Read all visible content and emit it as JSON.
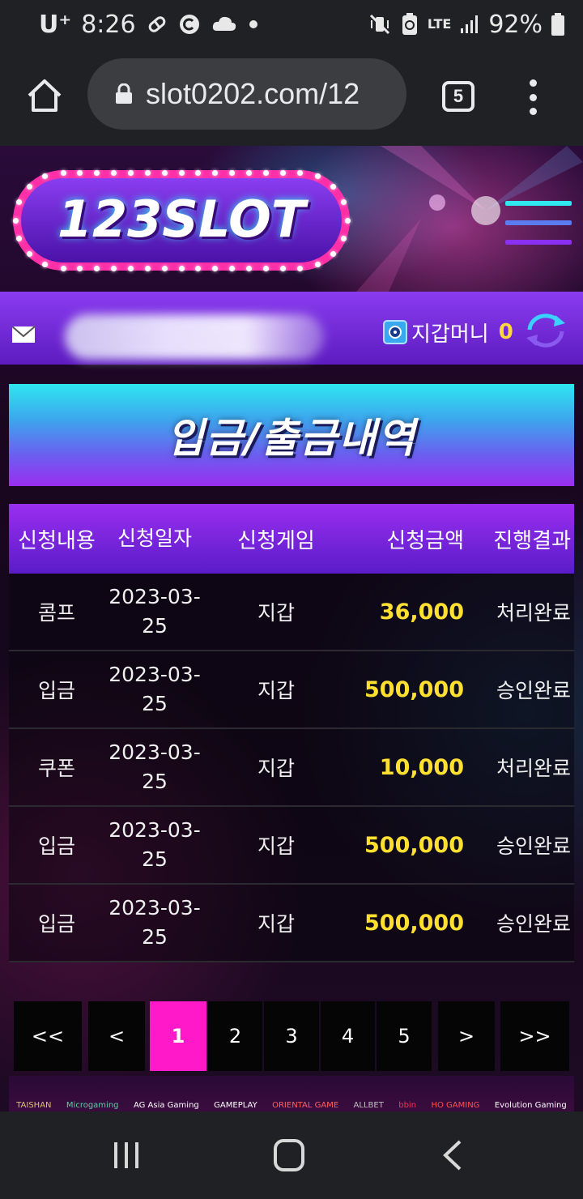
{
  "statusbar": {
    "carrier": "U⁺",
    "time": "8:26",
    "battery": "92%",
    "lte": "LTE"
  },
  "browser": {
    "url": "slot0202.com/12",
    "tab_count": "5"
  },
  "site": {
    "logo_text": "123SLOT",
    "wallet_label": "지갑머니",
    "wallet_amount": "0",
    "page_title": "입금/출금내역"
  },
  "table": {
    "headers": [
      "신청내용",
      "신청일자",
      "신청게임",
      "신청금액",
      "진행결과"
    ],
    "rows": [
      {
        "type": "콤프",
        "date": "2023-03-25",
        "game": "지갑",
        "amount": "36,000",
        "result": "처리완료"
      },
      {
        "type": "입금",
        "date": "2023-03-25",
        "game": "지갑",
        "amount": "500,000",
        "result": "승인완료"
      },
      {
        "type": "쿠폰",
        "date": "2023-03-25",
        "game": "지갑",
        "amount": "10,000",
        "result": "처리완료"
      },
      {
        "type": "입금",
        "date": "2023-03-25",
        "game": "지갑",
        "amount": "500,000",
        "result": "승인완료"
      },
      {
        "type": "입금",
        "date": "2023-03-25",
        "game": "지갑",
        "amount": "500,000",
        "result": "승인완료"
      }
    ]
  },
  "pagination": {
    "first": "<<",
    "prev": "<",
    "pages": [
      "1",
      "2",
      "3",
      "4",
      "5"
    ],
    "current": "1",
    "next": ">",
    "last": ">>"
  },
  "partners": [
    "TAISHAN",
    "Microgaming",
    "AG Asia Gaming",
    "GAMEPLAY",
    "ORIENTAL GAME",
    "ALLBET",
    "bbin",
    "HO GAMING",
    "Evolution Gaming"
  ],
  "colors": {
    "accent_pink": "#ff19c8",
    "amount_yellow": "#ffe030",
    "header_purple": "#9a2ef0",
    "banner_cyan": "#2ee6f0"
  }
}
